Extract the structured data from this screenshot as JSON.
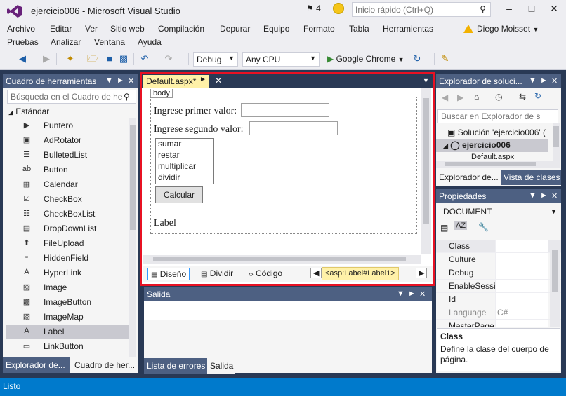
{
  "window": {
    "title": "ejercicio006 - Microsoft Visual Studio",
    "notifications": "4",
    "quick_launch_placeholder": "Inicio rápido (Ctrl+Q)",
    "user": "Diego Moisset"
  },
  "menu": [
    "Archivo",
    "Editar",
    "Ver",
    "Sitio web",
    "Compilación",
    "Depurar",
    "Equipo",
    "Formato",
    "Tabla",
    "Herramientas",
    "Pruebas",
    "Analizar",
    "Ventana",
    "Ayuda"
  ],
  "toolbar": {
    "config": "Debug",
    "platform": "Any CPU",
    "browser": "Google Chrome"
  },
  "toolbox": {
    "title": "Cuadro de herramientas",
    "search_placeholder": "Búsqueda en el Cuadro de he",
    "group": "Estándar",
    "items": [
      {
        "label": "Puntero",
        "icon": "pointer-icon"
      },
      {
        "label": "AdRotator",
        "icon": "adrotator-icon"
      },
      {
        "label": "BulletedList",
        "icon": "bulleted-list-icon"
      },
      {
        "label": "Button",
        "icon": "button-icon"
      },
      {
        "label": "Calendar",
        "icon": "calendar-icon"
      },
      {
        "label": "CheckBox",
        "icon": "checkbox-icon"
      },
      {
        "label": "CheckBoxList",
        "icon": "checkbox-list-icon"
      },
      {
        "label": "DropDownList",
        "icon": "dropdown-icon"
      },
      {
        "label": "FileUpload",
        "icon": "file-upload-icon"
      },
      {
        "label": "HiddenField",
        "icon": "hidden-field-icon"
      },
      {
        "label": "HyperLink",
        "icon": "hyperlink-icon"
      },
      {
        "label": "Image",
        "icon": "image-icon"
      },
      {
        "label": "ImageButton",
        "icon": "image-button-icon"
      },
      {
        "label": "ImageMap",
        "icon": "image-map-icon"
      },
      {
        "label": "Label",
        "icon": "label-icon"
      },
      {
        "label": "LinkButton",
        "icon": "link-button-icon"
      }
    ],
    "tabs": [
      "Explorador de...",
      "Cuadro de her..."
    ]
  },
  "editor": {
    "tab": "Default.aspx*",
    "body_tag": "body",
    "label1": "Ingrese primer valor:",
    "label2": "Ingrese segundo valor:",
    "options": [
      "sumar",
      "restar",
      "multiplicar",
      "dividir"
    ],
    "button": "Calcular",
    "label": "Label",
    "views": [
      "Diseño",
      "Dividir",
      "Código"
    ],
    "breadcrumb": "<asp:Label#Label1>"
  },
  "solution": {
    "title": "Explorador de soluci...",
    "search_placeholder": "Buscar en Explorador de s",
    "root": "Solución 'ejercicio006' (",
    "project": "ejercicio006",
    "file": "Default.aspx",
    "tabs": [
      "Explorador de...",
      "Vista de clases"
    ]
  },
  "properties": {
    "title": "Propiedades",
    "object": "DOCUMENT",
    "rows": [
      {
        "k": "Class",
        "v": ""
      },
      {
        "k": "Culture",
        "v": ""
      },
      {
        "k": "Debug",
        "v": ""
      },
      {
        "k": "EnableSessio",
        "v": ""
      },
      {
        "k": "Id",
        "v": ""
      },
      {
        "k": "Language",
        "v": "C#"
      },
      {
        "k": "MasterPage",
        "v": ""
      }
    ],
    "desc_title": "Class",
    "desc": "Define la clase del cuerpo de página."
  },
  "output": {
    "title": "Salida",
    "tabs": [
      "Lista de errores",
      "Salida"
    ]
  },
  "status": "Listo"
}
